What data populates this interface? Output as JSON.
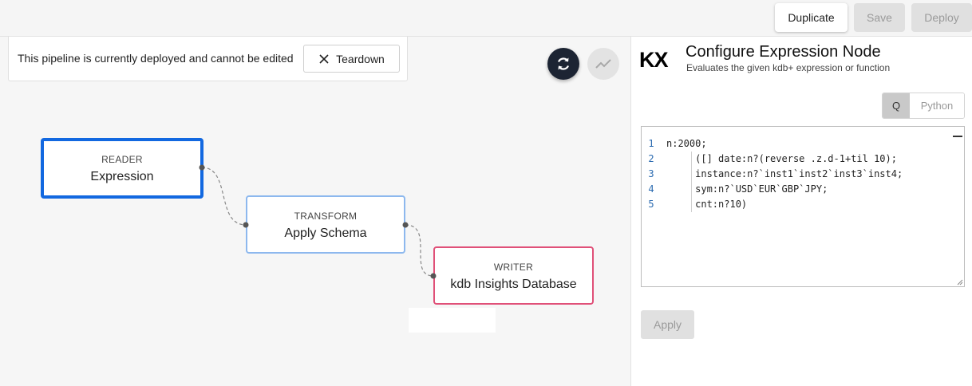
{
  "toolbar": {
    "duplicate_label": "Duplicate",
    "save_label": "Save",
    "deploy_label": "Deploy"
  },
  "notice": {
    "text": "This pipeline is currently deployed and cannot be edited",
    "teardown_label": "Teardown"
  },
  "nodes": {
    "reader": {
      "type": "READER",
      "label": "Expression",
      "border_color": "#1268e0"
    },
    "transform": {
      "type": "TRANSFORM",
      "label": "Apply Schema",
      "border_color": "#8db8ee"
    },
    "writer": {
      "type": "WRITER",
      "label": "kdb Insights Database",
      "border_color": "#e05078"
    }
  },
  "panel": {
    "logo": "KX",
    "title": "Configure Expression Node",
    "subtitle": "Evaluates the given kdb+ expression or function",
    "languages": [
      "Q",
      "Python"
    ],
    "selected_language": "Q",
    "code_lines": [
      "n:2000;",
      "     ([] date:n?(reverse .z.d-1+til 10);",
      "     instance:n?`inst1`inst2`inst3`inst4;",
      "     sym:n?`USD`EUR`GBP`JPY;",
      "     cnt:n?10)"
    ],
    "line_numbers": [
      "1",
      "2",
      "3",
      "4",
      "5"
    ],
    "apply_label": "Apply"
  },
  "colors": {
    "accent_dark": "#1c2433",
    "disabled_bg": "#e0e0e0"
  },
  "icons": [
    "close-icon",
    "refresh-icon",
    "trend-icon"
  ]
}
